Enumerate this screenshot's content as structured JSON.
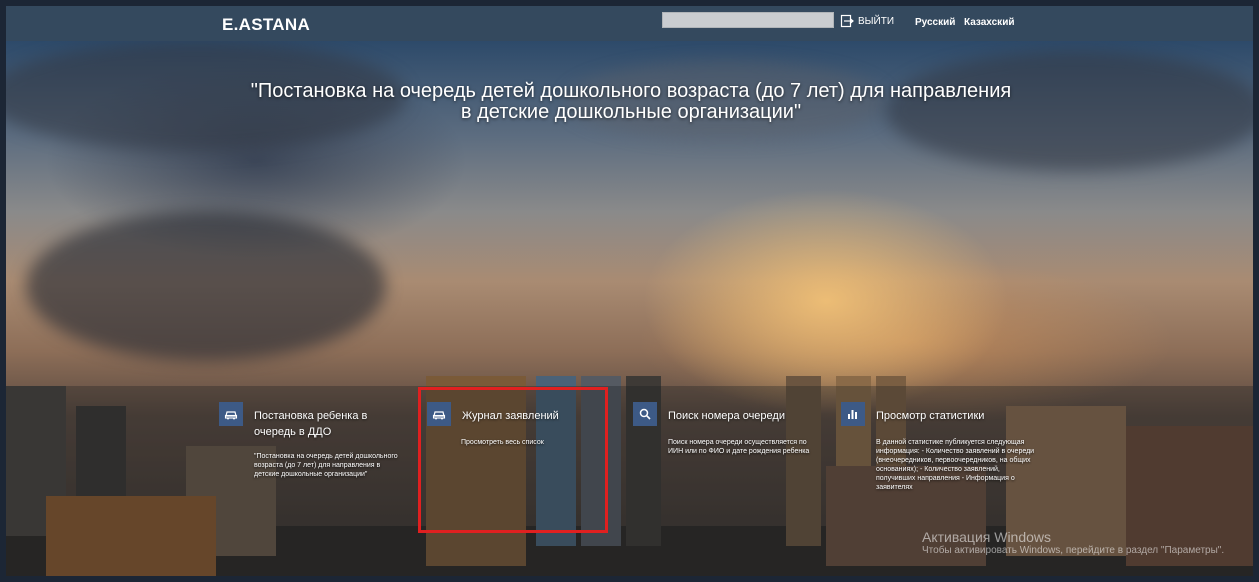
{
  "header": {
    "logo": "E.ASTANA",
    "logout_label": "ВЫЙТИ",
    "languages": [
      "Русский",
      "Казахский"
    ]
  },
  "hero": {
    "title": "\"Постановка на очередь детей дошкольного возраста (до 7 лет) для направления в детские дошкольные организации\""
  },
  "cards": [
    {
      "title": "Постановка ребенка в очередь в ДДО",
      "description": "\"Постановка на очередь детей дошкольного возраста (до 7 лет) для направления в детские дошкольные организации\"",
      "icon": "car-icon"
    },
    {
      "title": "Журнал заявлений",
      "description": "Просмотреть весь список",
      "icon": "car-icon"
    },
    {
      "title": "Поиск номера очереди",
      "description": "Поиск номера очереди осуществляется по ИИН или по ФИО и дате рождения ребенка",
      "icon": "search-icon"
    },
    {
      "title": "Просмотр статистики",
      "description": "В данной статистике публикуется следующая информация: - Количество заявлений в очереди (внеочередников, первоочередников, на общих основаниях); - Количество заявлений, получивших направления - Информация о заявителях",
      "icon": "bar-chart-icon"
    }
  ],
  "watermark": {
    "title": "Активация Windows",
    "subtitle": "Чтобы активировать Windows, перейдите в раздел \"Параметры\"."
  },
  "colors": {
    "header_bg": "#34495e",
    "card_icon_bg": "#3d5a86",
    "highlight": "#e02020"
  }
}
